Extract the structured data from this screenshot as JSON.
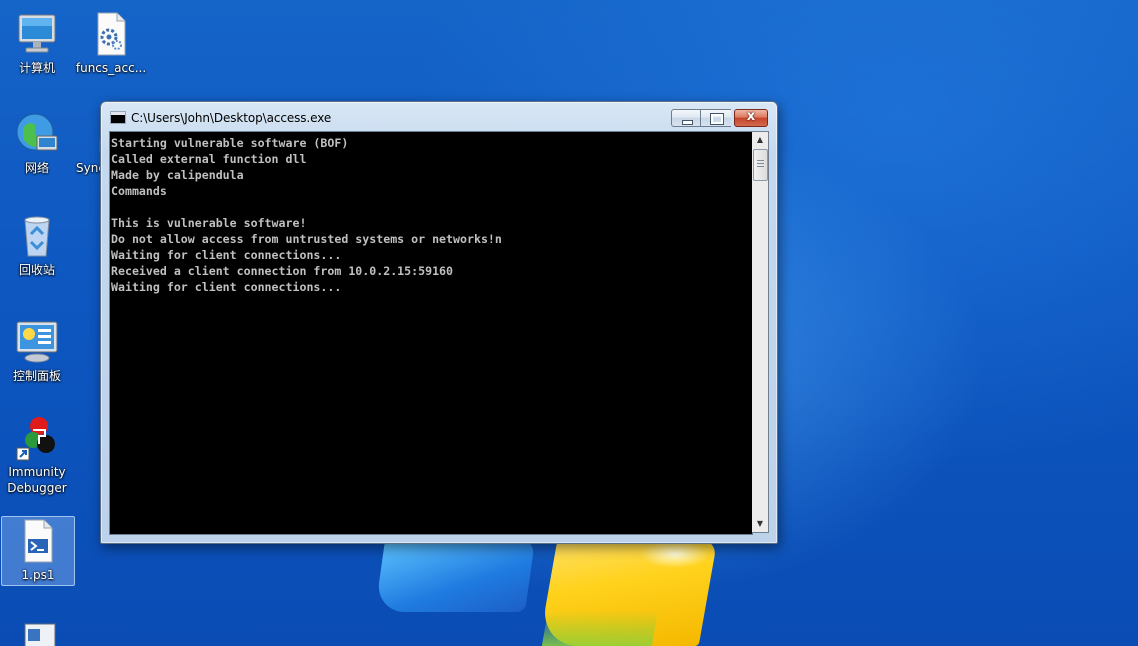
{
  "desktop": {
    "icons": [
      {
        "label": "计算机",
        "icon": "computer-icon"
      },
      {
        "label": "funcs_acc...",
        "icon": "settings-file-icon"
      },
      {
        "label": "网络",
        "icon": "network-icon"
      },
      {
        "label": "Sync",
        "icon": "sync-icon"
      },
      {
        "label": "回收站",
        "icon": "recycle-bin-icon"
      },
      {
        "label": "控制面板",
        "icon": "control-panel-icon"
      },
      {
        "label": "Immunity Debugger",
        "icon": "immunity-debugger-icon"
      },
      {
        "label": "1.ps1",
        "icon": "powershell-script-icon"
      }
    ]
  },
  "window": {
    "title": "C:\\Users\\John\\Desktop\\access.exe",
    "close_glyph": "x"
  },
  "console": {
    "lines": [
      "Starting vulnerable software (BOF)",
      "Called external function dll",
      "Made by calipendula",
      "Commands",
      "",
      "This is vulnerable software!",
      "Do not allow access from untrusted systems or networks!n",
      "Waiting for client connections...",
      "Received a client connection from 10.0.2.15:59160",
      "Waiting for client connections..."
    ]
  },
  "colors": {
    "console_bg": "#000000",
    "console_fg": "#c0c0c0",
    "desktop_blue": "#1564c8"
  }
}
